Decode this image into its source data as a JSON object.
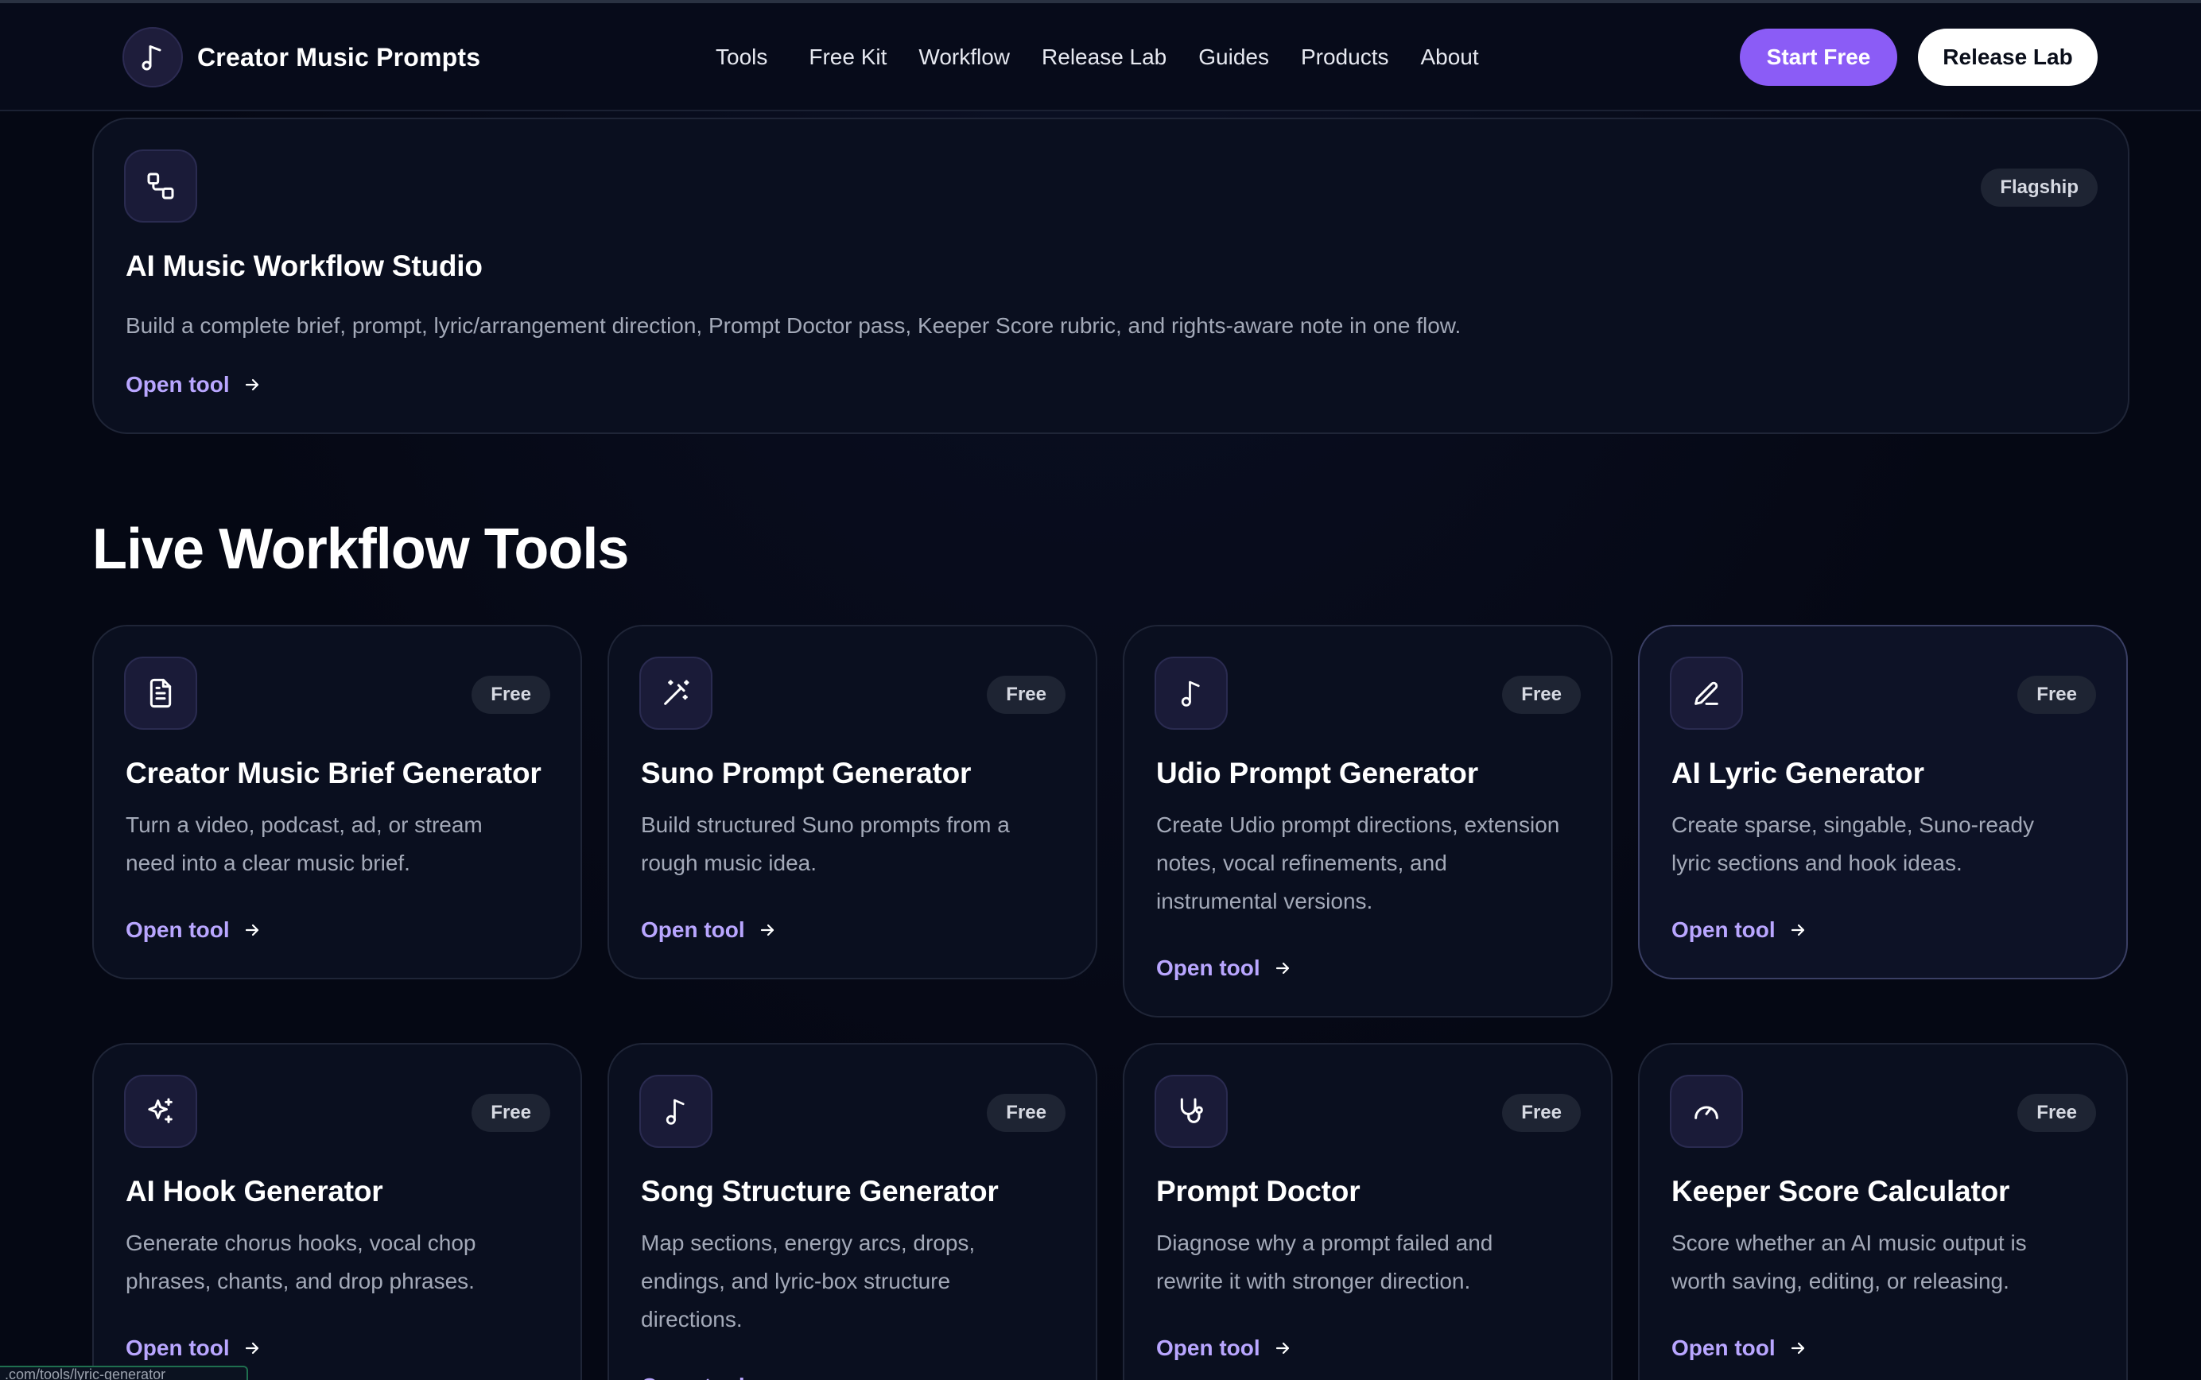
{
  "brand": {
    "name": "Creator Music Prompts",
    "icon": "music-note-icon"
  },
  "nav": {
    "items": [
      "Tools",
      "Free Kit",
      "Workflow",
      "Release Lab",
      "Guides",
      "Products",
      "About"
    ],
    "start_button": "Start Free",
    "release_button": "Release Lab"
  },
  "flagship": {
    "icon": "workflow-icon",
    "badge": "Flagship",
    "title": "AI Music Workflow Studio",
    "description": "Build a complete brief, prompt, lyric/arrangement direction, Prompt Doctor pass, Keeper Score rubric, and rights-aware note in one flow.",
    "link": "Open tool"
  },
  "section": {
    "title": "Live Workflow Tools"
  },
  "tools": [
    {
      "icon": "document-icon",
      "badge": "Free",
      "title": "Creator Music Brief Generator",
      "desc_lines": [
        "Turn a video, podcast, ad, or stream",
        "need into a clear music brief."
      ],
      "link": "Open tool"
    },
    {
      "icon": "magic-wand-icon",
      "badge": "Free",
      "title": "Suno Prompt Generator",
      "desc_lines": [
        "Build structured Suno prompts from a",
        "rough music idea."
      ],
      "link": "Open tool"
    },
    {
      "icon": "music-note-icon",
      "badge": "Free",
      "title": "Udio Prompt Generator",
      "desc_lines": [
        "Create Udio prompt directions, extension",
        "notes, vocal refinements, and",
        "instrumental versions."
      ],
      "link": "Open tool"
    },
    {
      "icon": "pen-icon",
      "badge": "Free",
      "title": "AI Lyric Generator",
      "desc_lines": [
        "Create sparse, singable, Suno-ready",
        "lyric sections and hook ideas."
      ],
      "link": "Open tool"
    },
    {
      "icon": "sparkles-icon",
      "badge": "Free",
      "title": "AI Hook Generator",
      "desc_lines": [
        "Generate chorus hooks, vocal chop",
        "phrases, chants, and drop phrases."
      ],
      "link": "Open tool"
    },
    {
      "icon": "music-note-icon",
      "badge": "Free",
      "title": "Song Structure Generator",
      "desc_lines": [
        "Map sections, energy arcs, drops,",
        "endings, and lyric-box structure",
        "directions."
      ],
      "link": "Open tool"
    },
    {
      "icon": "stethoscope-icon",
      "badge": "Free",
      "title": "Prompt Doctor",
      "desc_lines": [
        "Diagnose why a prompt failed and",
        "rewrite it with stronger direction."
      ],
      "link": "Open tool"
    },
    {
      "icon": "gauge-icon",
      "badge": "Free",
      "title": "Keeper Score Calculator",
      "desc_lines": [
        "Score whether an AI music output is",
        "worth saving, editing, or releasing."
      ],
      "link": "Open tool"
    }
  ],
  "status_bar": {
    "url": ".com/tools/lyric-generator"
  },
  "colors": {
    "accent": "#8b5cf6",
    "link": "#b9a6ff",
    "background": "#050814"
  }
}
